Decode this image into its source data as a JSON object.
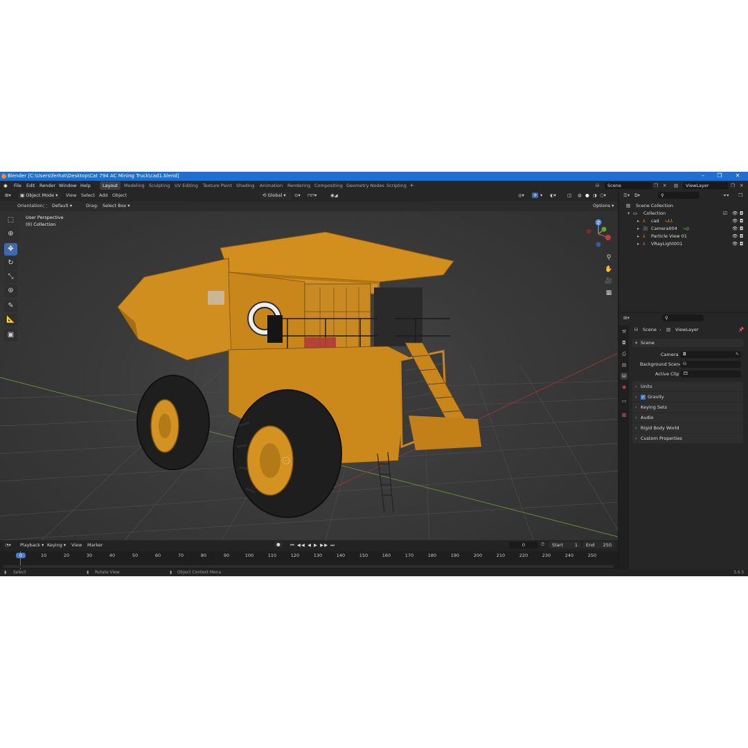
{
  "window": {
    "title": "Blender [C:\\Users\\ferhat\\Desktop\\Cat 794 AC Mining Truck\\cad1.blend]"
  },
  "menu": [
    "File",
    "Edit",
    "Render",
    "Window",
    "Help"
  ],
  "workspaces": [
    "Layout",
    "Modeling",
    "Sculpting",
    "UV Editing",
    "Texture Paint",
    "Shading",
    "Animation",
    "Rendering",
    "Compositing",
    "Geometry Nodes",
    "Scripting"
  ],
  "scene_selector": {
    "scene": "Scene",
    "view_layer": "ViewLayer"
  },
  "viewport_header": {
    "mode": "Object Mode",
    "menus": [
      "View",
      "Select",
      "Add",
      "Object"
    ],
    "transform": "Global",
    "options": "Options"
  },
  "tool_settings": {
    "orientation_label": "Orientation:",
    "orientation": "Default",
    "drag_label": "Drag:",
    "drag": "Select Box"
  },
  "viewport_info": {
    "line1": "User Perspective",
    "line2": "(0) Collection"
  },
  "gizmo": {
    "z": "Z"
  },
  "outliner": {
    "root": "Scene Collection",
    "collection": "Collection",
    "items": [
      "cad",
      "Camera004",
      "Particle View 01",
      "VRayLight001"
    ]
  },
  "properties": {
    "breadcrumb_scene": "Scene",
    "breadcrumb_layer": "ViewLayer",
    "section": "Scene",
    "camera_label": "Camera",
    "background_label": "Background Scene",
    "clip_label": "Active Clip",
    "panels": [
      "Units",
      "Gravity",
      "Keying Sets",
      "Audio",
      "Rigid Body World",
      "Custom Properties"
    ],
    "gravity_checked": true
  },
  "timeline": {
    "menus": [
      "Playback",
      "Keying",
      "View",
      "Marker"
    ],
    "current_frame": "0",
    "start_label": "Start",
    "start": "1",
    "end_label": "End",
    "end": "250",
    "ticks": [
      "0",
      "10",
      "20",
      "30",
      "40",
      "50",
      "60",
      "70",
      "80",
      "90",
      "100",
      "110",
      "120",
      "130",
      "140",
      "150",
      "160",
      "170",
      "180",
      "190",
      "200",
      "210",
      "220",
      "230",
      "240",
      "250"
    ]
  },
  "statusbar": {
    "select": "Select",
    "rotate": "Rotate View",
    "context": "Object Context Menu",
    "version": "3.6.5"
  },
  "colors": {
    "accent": "#1e6fd1",
    "truck_yellow": "#d9951f",
    "active_blue": "#3e6bb0"
  }
}
